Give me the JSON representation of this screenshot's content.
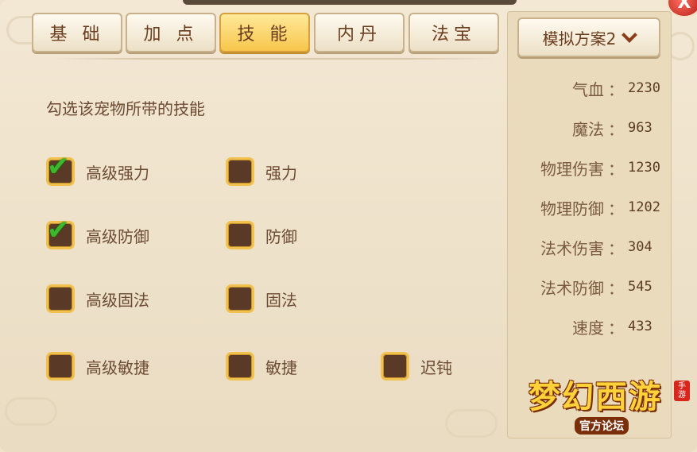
{
  "tabs": [
    "基 础",
    "加 点",
    "技 能",
    "内丹",
    "法宝"
  ],
  "active_tab_index": 2,
  "instruction": "勾选该宠物所带的技能",
  "skills": [
    {
      "label": "高级强力",
      "checked": true
    },
    {
      "label": "强力",
      "checked": false
    },
    {
      "label": "高级防御",
      "checked": true
    },
    {
      "label": "防御",
      "checked": false
    },
    {
      "label": "高级固法",
      "checked": false
    },
    {
      "label": "固法",
      "checked": false
    },
    {
      "label": "高级敏捷",
      "checked": false
    },
    {
      "label": "敏捷",
      "checked": false
    },
    {
      "label": "迟钝",
      "checked": false
    }
  ],
  "scheme": {
    "label": "模拟方案2"
  },
  "stats": [
    {
      "name": "气血",
      "value": "2230"
    },
    {
      "name": "魔法",
      "value": "963"
    },
    {
      "name": "物理伤害",
      "value": "1230"
    },
    {
      "name": "物理防御",
      "value": "1202"
    },
    {
      "name": "法术伤害",
      "value": "304"
    },
    {
      "name": "法术防御",
      "value": "545"
    },
    {
      "name": "速度",
      "value": "433"
    }
  ],
  "stat_separator": "：",
  "logo": {
    "title": "梦幻西游",
    "badge": "手游",
    "subtitle": "官方论坛"
  },
  "close_label": "X",
  "check_glyph": "✔",
  "colors": {
    "accent_tab": "#f7c64b",
    "checkbox_fill": "#5a3a26",
    "checkbox_border": "#f1c14e",
    "check": "#39b92b",
    "text": "#6b4a33"
  }
}
